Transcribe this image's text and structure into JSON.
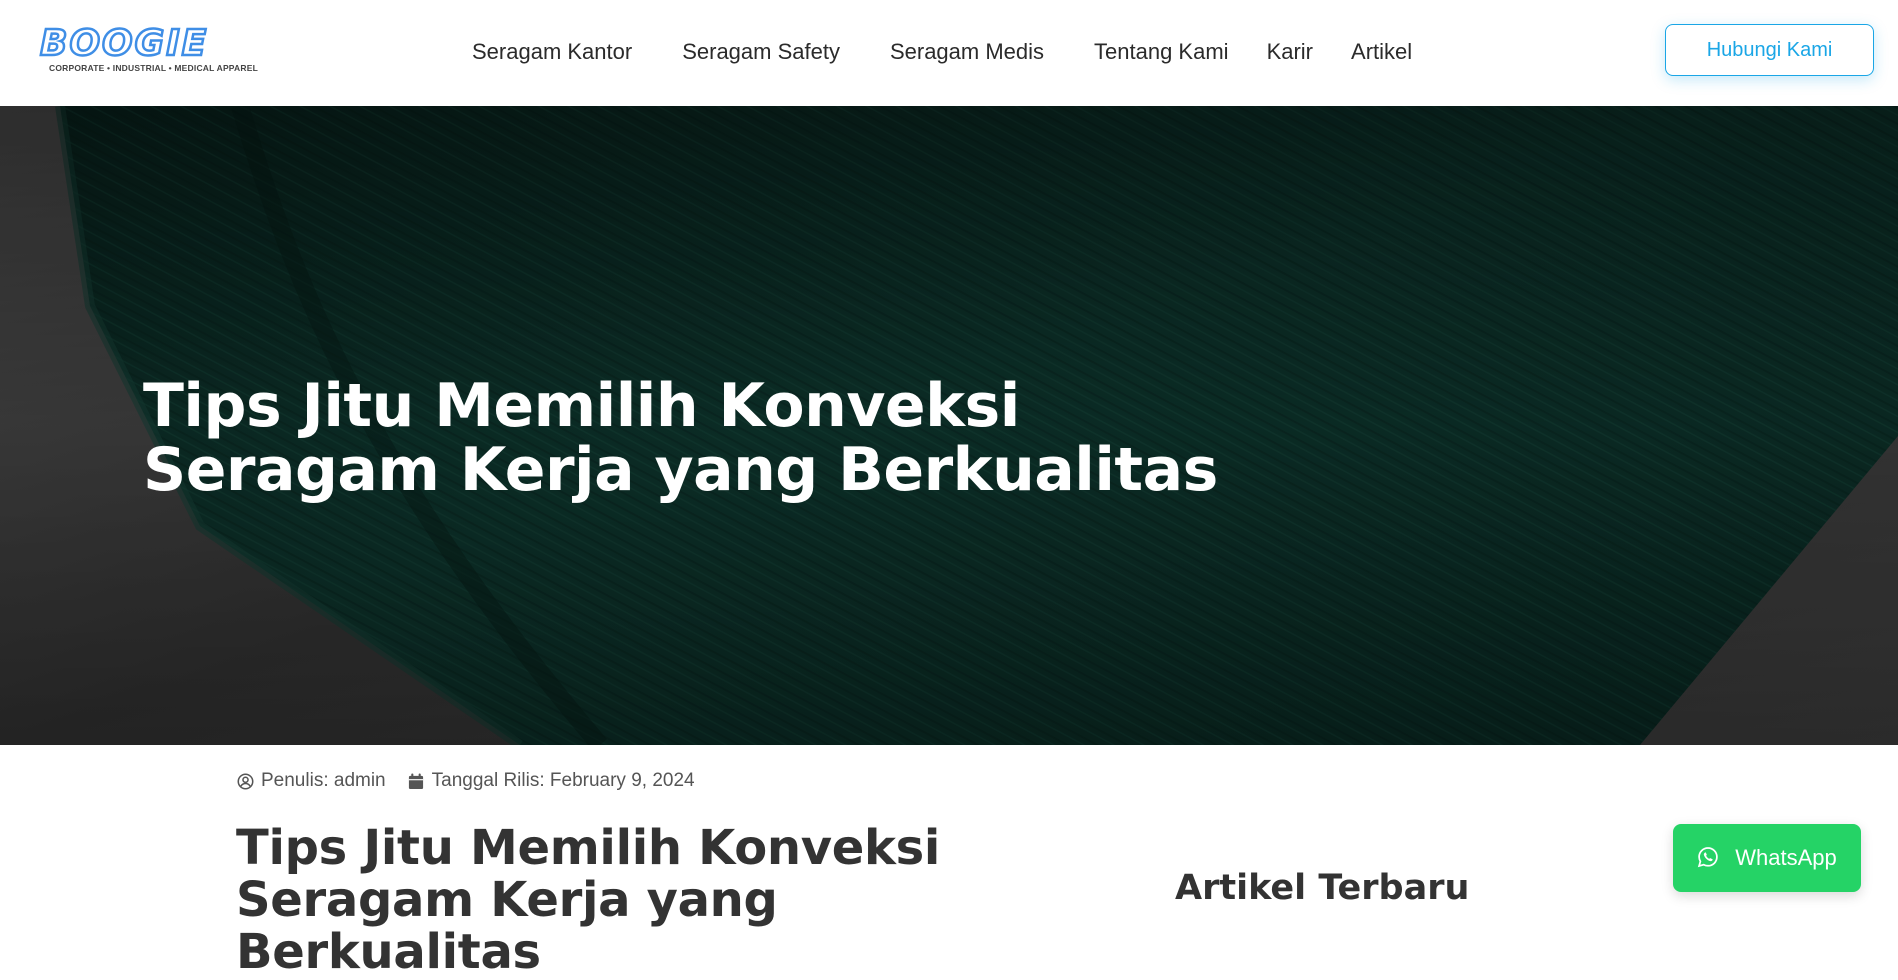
{
  "brand": {
    "logo_text": "BOOGIE",
    "tagline": "CORPORATE • INDUSTRIAL • MEDICAL APPAREL",
    "accent": "#3f8ee6"
  },
  "nav": {
    "items": [
      {
        "label": "Seragam Kantor"
      },
      {
        "label": "Seragam Safety"
      },
      {
        "label": "Seragam Medis"
      },
      {
        "label": "Tentang Kami"
      },
      {
        "label": "Karir"
      },
      {
        "label": "Artikel"
      }
    ],
    "contact_button": "Hubungi Kami",
    "contact_color": "#1aa6e6"
  },
  "hero": {
    "title": "Tips Jitu Memilih Konveksi Seragam Kerja yang Berkualitas",
    "fabric_color": "#0d3a30"
  },
  "article": {
    "author_label": "Penulis: admin",
    "date_label": "Tanggal Rilis: February 9, 2024",
    "title": "Tips Jitu Memilih Konveksi Seragam Kerja yang Berkualitas",
    "author_icon": "user-circle-icon",
    "date_icon": "calendar-icon"
  },
  "sidebar": {
    "title": "Artikel Terbaru"
  },
  "whatsapp": {
    "label": "WhatsApp",
    "icon": "whatsapp-icon",
    "color": "#25d366"
  }
}
